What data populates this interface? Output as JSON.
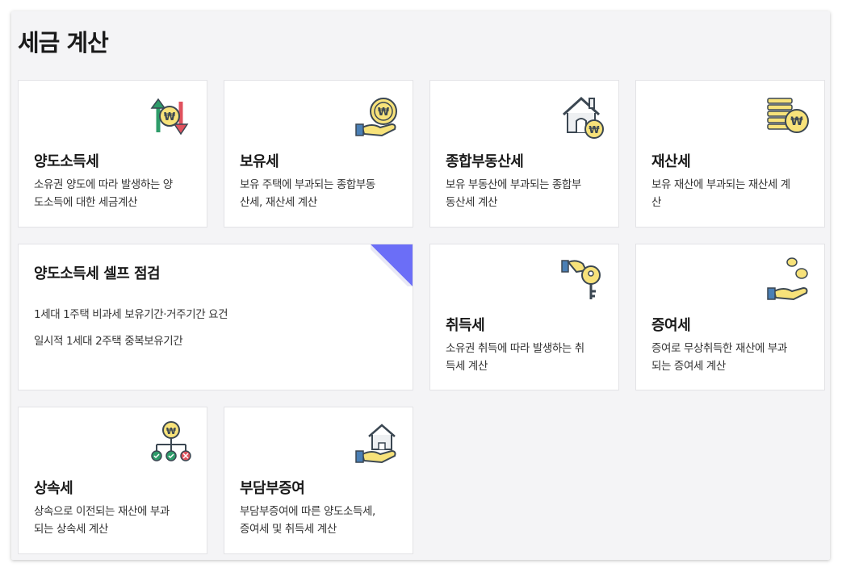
{
  "page_title": "세금 계산",
  "cards": {
    "yangdo": {
      "title": "양도소득세",
      "desc_1": "소유권 양도에 따라 발생하는 양",
      "desc_2": "도소득에 대한 세금계산",
      "icon": "transfer-arrows-won-icon"
    },
    "boyu": {
      "title": "보유세",
      "desc_1": "보유 주택에 부과되는 종합부동",
      "desc_2": "산세, 재산세 계산",
      "icon": "hand-coin-icon"
    },
    "jonghap": {
      "title": "종합부동산세",
      "desc_1": "보유 부동산에 부과되는 종합부",
      "desc_2": "동산세 계산",
      "icon": "house-coin-icon"
    },
    "jaesan": {
      "title": "재산세",
      "desc_1": "보유 재산에 부과되는 재산세 계",
      "desc_2": "산",
      "icon": "coin-stack-icon"
    },
    "self_check": {
      "title": "양도소득세 셀프 점검",
      "line_1": "1세대 1주택 비과세 보유기간·거주기간 요건",
      "line_2": "일시적 1세대 2주택 중복보유기간"
    },
    "chideuk": {
      "title": "취득세",
      "desc_1": "소유권 취득에 따라 발생하는 취",
      "desc_2": "득세 계산",
      "icon": "hand-key-icon"
    },
    "jeungyeo": {
      "title": "증여세",
      "desc_1": "증여로 무상취득한 재산에 부과",
      "desc_2": "되는 증여세 계산",
      "icon": "hand-falling-coins-icon"
    },
    "sangsok": {
      "title": "상속세",
      "desc_1": "상속으로 이전되는 재산에 부과",
      "desc_2": "되는 상속세 계산",
      "icon": "inheritance-tree-icon"
    },
    "budam": {
      "title": "부담부증여",
      "desc_1": "부담부증여에 따른 양도소득세,",
      "desc_2": "증여세 및 취득세 계산",
      "icon": "hand-house-icon"
    }
  },
  "colors": {
    "accent": "#6b6ef7",
    "coin": "#f7e27a",
    "stroke": "#3b4752",
    "green": "#2e9c6a",
    "red": "#e0525e",
    "blue": "#4a7fb5"
  }
}
